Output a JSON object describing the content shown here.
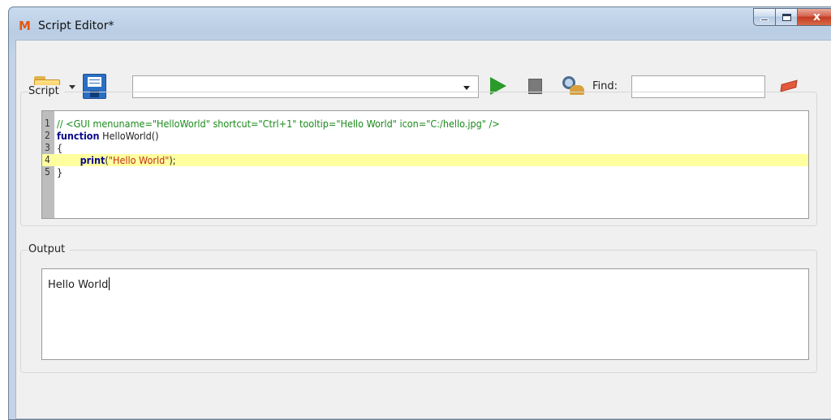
{
  "window": {
    "title": "Script Editor*",
    "app_icon_glyph": "M",
    "controls": {
      "minimize_icon": "minimize-icon",
      "maximize_icon": "maximize-icon",
      "close_label": "x"
    }
  },
  "toolbar": {
    "open_icon": "folder-open-icon",
    "save_icon": "floppy-save-icon",
    "script_select_value": "",
    "run_icon": "play-icon",
    "stop_icon": "stop-icon",
    "find_icon": "find-binoculars-icon",
    "find_label": "Find:",
    "find_value": "",
    "clear_icon": "eraser-icon"
  },
  "script_panel": {
    "label": "Script",
    "current_line": 4,
    "lines": [
      {
        "num": "1",
        "tokens": [
          {
            "type": "comment",
            "text": "// <GUI menuname=\"HelloWorld\" shortcut=\"Ctrl+1\" tooltip=\"Hello World\" icon=\"C:/hello.jpg\" />"
          }
        ]
      },
      {
        "num": "2",
        "tokens": [
          {
            "type": "keyword",
            "text": "function"
          },
          {
            "type": "plain",
            "text": " HelloWorld()"
          }
        ]
      },
      {
        "num": "3",
        "tokens": [
          {
            "type": "plain",
            "text": "{"
          }
        ]
      },
      {
        "num": "4",
        "tokens": [
          {
            "type": "plain",
            "text": "        "
          },
          {
            "type": "keyword",
            "text": "print"
          },
          {
            "type": "plain",
            "text": "("
          },
          {
            "type": "string",
            "text": "\"Hello World\""
          },
          {
            "type": "plain",
            "text": ");"
          }
        ]
      },
      {
        "num": "5",
        "tokens": [
          {
            "type": "plain",
            "text": "}"
          }
        ]
      }
    ]
  },
  "output_panel": {
    "label": "Output",
    "text": "Hello World"
  },
  "colors": {
    "comment": "#1a8a1a",
    "keyword": "#0a0a8a",
    "string": "#c0311a",
    "current_line_highlight": "#ffff9f",
    "run_button": "#2a9a2a"
  }
}
